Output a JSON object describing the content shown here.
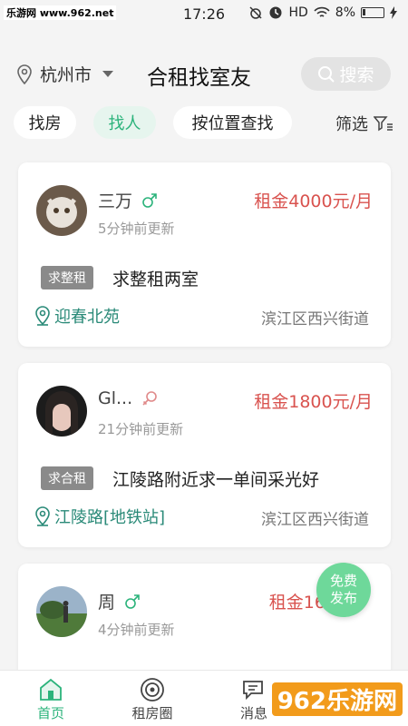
{
  "status": {
    "watermark": "乐游网 www.962.net",
    "time": "17:26",
    "hd": "HD",
    "battery": "8%"
  },
  "header": {
    "city": "杭州市",
    "title": "合租找室友",
    "search_label": "搜索"
  },
  "filters": {
    "chips": [
      "找房",
      "找人",
      "按位置查找"
    ],
    "active": "找人",
    "filter_label": "筛选"
  },
  "listings": [
    {
      "name": "三万",
      "gender": "male",
      "updated": "5分钟前更新",
      "rent": "租金4000元/月",
      "tag": "求整租",
      "desc": "求整租两室",
      "location": "迎春北苑",
      "district": "滨江区西兴街道"
    },
    {
      "name": "Gl...",
      "gender": "female",
      "updated": "21分钟前更新",
      "rent": "租金1800元/月",
      "tag": "求合租",
      "desc": "江陵路附近求一单间采光好",
      "location": "江陵路[地铁站]",
      "district": "滨江区西兴街道"
    },
    {
      "name": "周",
      "gender": "male",
      "updated": "4分钟前更新",
      "rent": "租金160",
      "tag": "",
      "desc": "",
      "location": "",
      "district": ""
    }
  ],
  "fab": {
    "line1": "免费",
    "line2": "发布"
  },
  "tabs": [
    {
      "label": "首页",
      "icon": "home-icon",
      "active": true
    },
    {
      "label": "租房圈",
      "icon": "circle-icon",
      "active": false
    },
    {
      "label": "消息",
      "icon": "chat-icon",
      "active": false
    }
  ],
  "colors": {
    "accent": "#2bb37b",
    "rent": "#d9534f",
    "male": "#2bb37b",
    "female": "#e08a8a"
  },
  "bottom_watermark": "962乐游网"
}
